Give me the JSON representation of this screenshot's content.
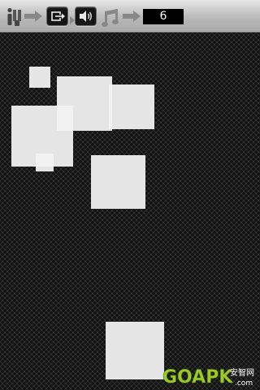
{
  "toolbar": {
    "icons": [
      "info-icon",
      "exit-icon",
      "speaker-icon",
      "music-note-icon"
    ],
    "score": "6"
  },
  "board": {
    "blocks_count": 8
  },
  "watermark": {
    "brand": "GOAPK",
    "chinese": "安智网",
    "domain": ".com"
  },
  "colors": {
    "toolbar": "#c4c4c4",
    "score_bg": "#000000",
    "score_text": "#ffffff",
    "block": "#f2f2f2",
    "board": "#2e2e2e",
    "watermark_green": "#9ccb2a"
  }
}
